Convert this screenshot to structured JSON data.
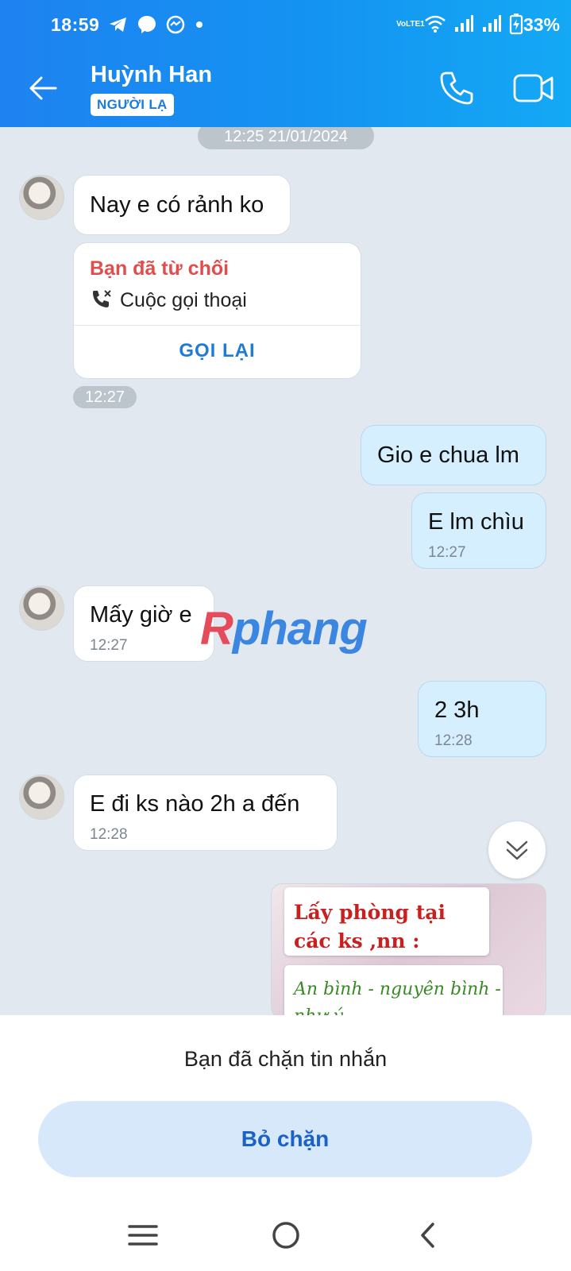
{
  "status_bar": {
    "time": "18:59",
    "battery": "33%",
    "network_label": "VoLTE1"
  },
  "header": {
    "contact_name": "Huỳnh Han",
    "badge": "NGƯỜI LẠ",
    "accent_color": "#1b7be0"
  },
  "chat": {
    "date_separator": "12:25 21/01/2024",
    "messages": [
      {
        "from": "them",
        "text": "Nay e có rảnh ko"
      },
      {
        "from": "them",
        "type": "call",
        "title": "Bạn đã từ chối",
        "subtitle": "Cuộc gọi thoại",
        "action": "GỌI LẠI",
        "time": "12:27"
      },
      {
        "from": "me",
        "text": "Gio e chua lm"
      },
      {
        "from": "me",
        "text": "E lm chìu",
        "time": "12:27"
      },
      {
        "from": "them",
        "text": "Mấy giờ e",
        "time": "12:27"
      },
      {
        "from": "me",
        "text": "2 3h",
        "time": "12:28"
      },
      {
        "from": "them",
        "text": "E đi ks nào 2h a đến",
        "time": "12:28"
      },
      {
        "from": "me",
        "type": "image",
        "image_text_1": "Lấy phòng tại các ks ,nn :",
        "image_text_2": "An bình - nguyên bình - như ý"
      }
    ]
  },
  "watermark": {
    "first": "R",
    "rest": "phang"
  },
  "block_panel": {
    "message": "Bạn đã chặn tin nhắn",
    "button_label": "Bỏ chặn"
  }
}
